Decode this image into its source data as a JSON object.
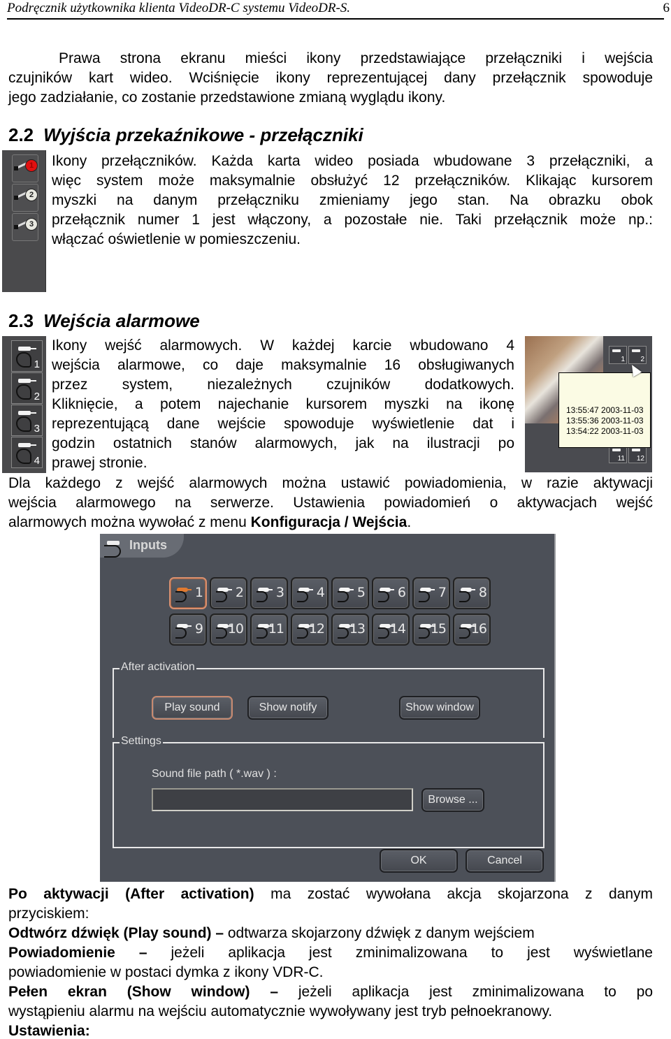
{
  "header": {
    "title": "Podręcznik użytkownika klienta VideoDR-C systemu VideoDR-S.",
    "page_number": "6"
  },
  "intro": {
    "lines": [
      "Prawa strona ekranu mieści ikony przedstawiające przełączniki i wejścia",
      "czujników kart wideo. Wciśnięcie ikony reprezentującej dany przełącznik spowoduje",
      "jego zadziałanie, co zostanie przedstawione zmianą wyglądu ikony."
    ]
  },
  "section_2_2": {
    "number": "2.2",
    "title": "Wyjścia przekaźnikowe - przełączniki",
    "lines": [
      "Ikony przełączników. Każda karta wideo posiada wbudowane 3 przełączniki, a",
      "więc system może maksymalnie obsłużyć 12 przełączników. Klikając kursorem",
      "myszki na danym przełączniku zmieniamy jego stan. Na obrazku obok",
      "przełącznik numer 1 jest włączony, a pozostałe nie. Taki przełącznik może np.:",
      "włączać oświetlenie w pomieszczeniu."
    ],
    "switches": [
      {
        "number": "1",
        "state": "on"
      },
      {
        "number": "2",
        "state": "off"
      },
      {
        "number": "3",
        "state": "off"
      }
    ]
  },
  "section_2_3": {
    "number": "2.3",
    "title": "Wejścia alarmowe",
    "lines": [
      "Ikony wejść alarmowych. W każdej karcie wbudowano 4",
      "wejścia alarmowe, co daje maksymalnie 16 obsługiwanych",
      "przez system, niezależnych czujników dodatkowych.",
      "Kliknięcie, a potem najechanie kursorem myszki na ikonę",
      "reprezentującą dane wejście spowoduje wyświetlenie dat i",
      "godzin ostatnich stanów alarmowych, jak na ilustracji po",
      "prawej stronie."
    ],
    "alarm_inputs": [
      "1",
      "2",
      "3",
      "4"
    ],
    "screenshot": {
      "buttons": [
        "1",
        "2",
        "11",
        "12"
      ],
      "tooltip_lines": [
        "13:55:47 2003-11-03",
        "13:55:36 2003-11-03",
        "13:54:22 2003-11-03"
      ]
    },
    "after_lines": [
      "Dla każdego z wejść alarmowych można ustawić powiadomienia, w razie aktywacji",
      "wejścia alarmowego na serwerze. Ustawienia powiadomień o aktywacjach wejść"
    ],
    "last_line_prefix": "alarmowych można wywołać z menu ",
    "last_line_bold": "Konfiguracja / Wejścia",
    "last_line_suffix": "."
  },
  "dialog": {
    "title": "Inputs",
    "inputs": [
      "1",
      "2",
      "3",
      "4",
      "5",
      "6",
      "7",
      "8",
      "9",
      "10",
      "11",
      "12",
      "13",
      "14",
      "15",
      "16"
    ],
    "active_input": "1",
    "after_activation_label": "After activation",
    "buttons": {
      "play_sound": "Play sound",
      "show_notify": "Show notify",
      "show_window": "Show window",
      "browse": "Browse ...",
      "ok": "OK",
      "cancel": "Cancel"
    },
    "active_action": "Play sound",
    "settings_label": "Settings",
    "sound_path_label": "Sound file path ( *.wav ) :",
    "sound_path_value": "",
    "accent_color": "#d89070"
  },
  "description": {
    "p1_bold": "Po aktywacji (After activation)",
    "p1_rest": " ma zostać wywołana akcja skojarzona z danym",
    "p1_line2": "przyciskiem:",
    "p2_bold": "Odtwórz dźwięk (Play sound) –",
    "p2_rest": " odtwarza skojarzony dźwięk z danym wejściem",
    "p3_bold": "Powiadomienie –",
    "p3_rest": " jeżeli aplikacja jest zminimalizowana to jest wyświetlane",
    "p3_line2": "powiadomienie w postaci dymka z ikony VDR-C.",
    "p4_bold": "Pełen ekran (Show window) –",
    "p4_rest": " jeżeli aplikacja jest zminimalizowana to po",
    "p4_line2": "wystąpieniu alarmu na wejściu automatycznie wywoływany jest tryb pełnoekranowy.",
    "p5_bold": "Ustawienia:"
  }
}
